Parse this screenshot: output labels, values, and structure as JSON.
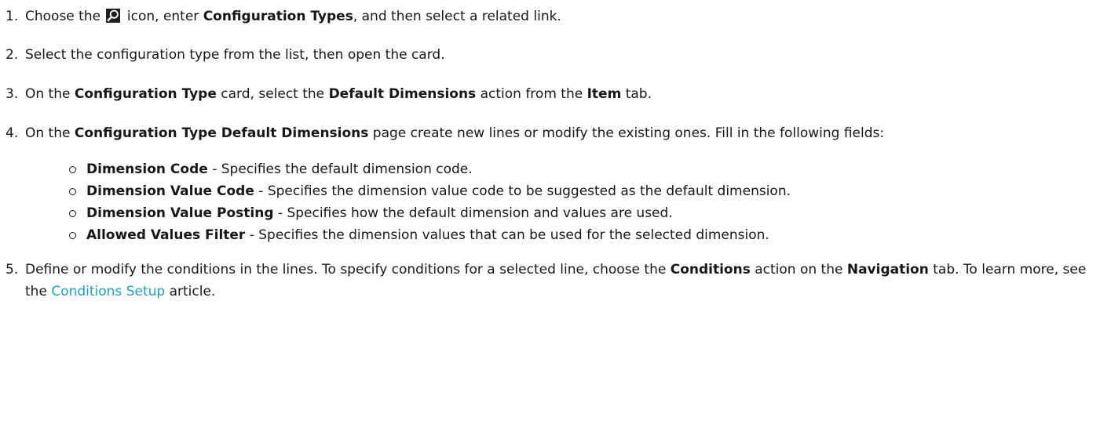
{
  "steps": {
    "s1": {
      "num": "1.",
      "pre": "Choose the",
      "icon": "search-icon",
      "mid": " icon, enter ",
      "bold": "Configuration Types",
      "post": ", and then select a related link."
    },
    "s2": {
      "num": "2.",
      "text": "Select the configuration type from the list, then open the card."
    },
    "s3": {
      "num": "3.",
      "pre": "On the ",
      "bold1": "Configuration Type",
      "mid1": " card, select the ",
      "bold2": "Default Dimensions",
      "mid2": " action from the ",
      "bold3": "Item",
      "post": " tab."
    },
    "s4": {
      "num": "4.",
      "pre": "On the ",
      "bold": "Configuration Type Default Dimensions",
      "post": " page create new lines or modify the existing ones. Fill in the following fields:",
      "fields": [
        {
          "name": "Dimension Code",
          "desc": " - Specifies the default dimension code."
        },
        {
          "name": "Dimension Value Code",
          "desc": " - Specifies the dimension value code to be suggested as the default dimension."
        },
        {
          "name": "Dimension Value Posting",
          "desc": " - Specifies how the default dimension and values are used."
        },
        {
          "name": "Allowed Values Filter",
          "desc": " - Specifies the dimension values that can be used for the selected dimension."
        }
      ]
    },
    "s5": {
      "num": "5.",
      "pre": "Define or modify the conditions in the lines. To specify conditions for a selected line, choose the ",
      "bold1": "Conditions",
      "mid": " action on the ",
      "bold2": "Navigation",
      "mid2": " tab. To learn more, see the ",
      "link": "Conditions Setup",
      "post": " article."
    }
  },
  "colors": {
    "text": "#171717",
    "link": "#1aa1c7"
  }
}
